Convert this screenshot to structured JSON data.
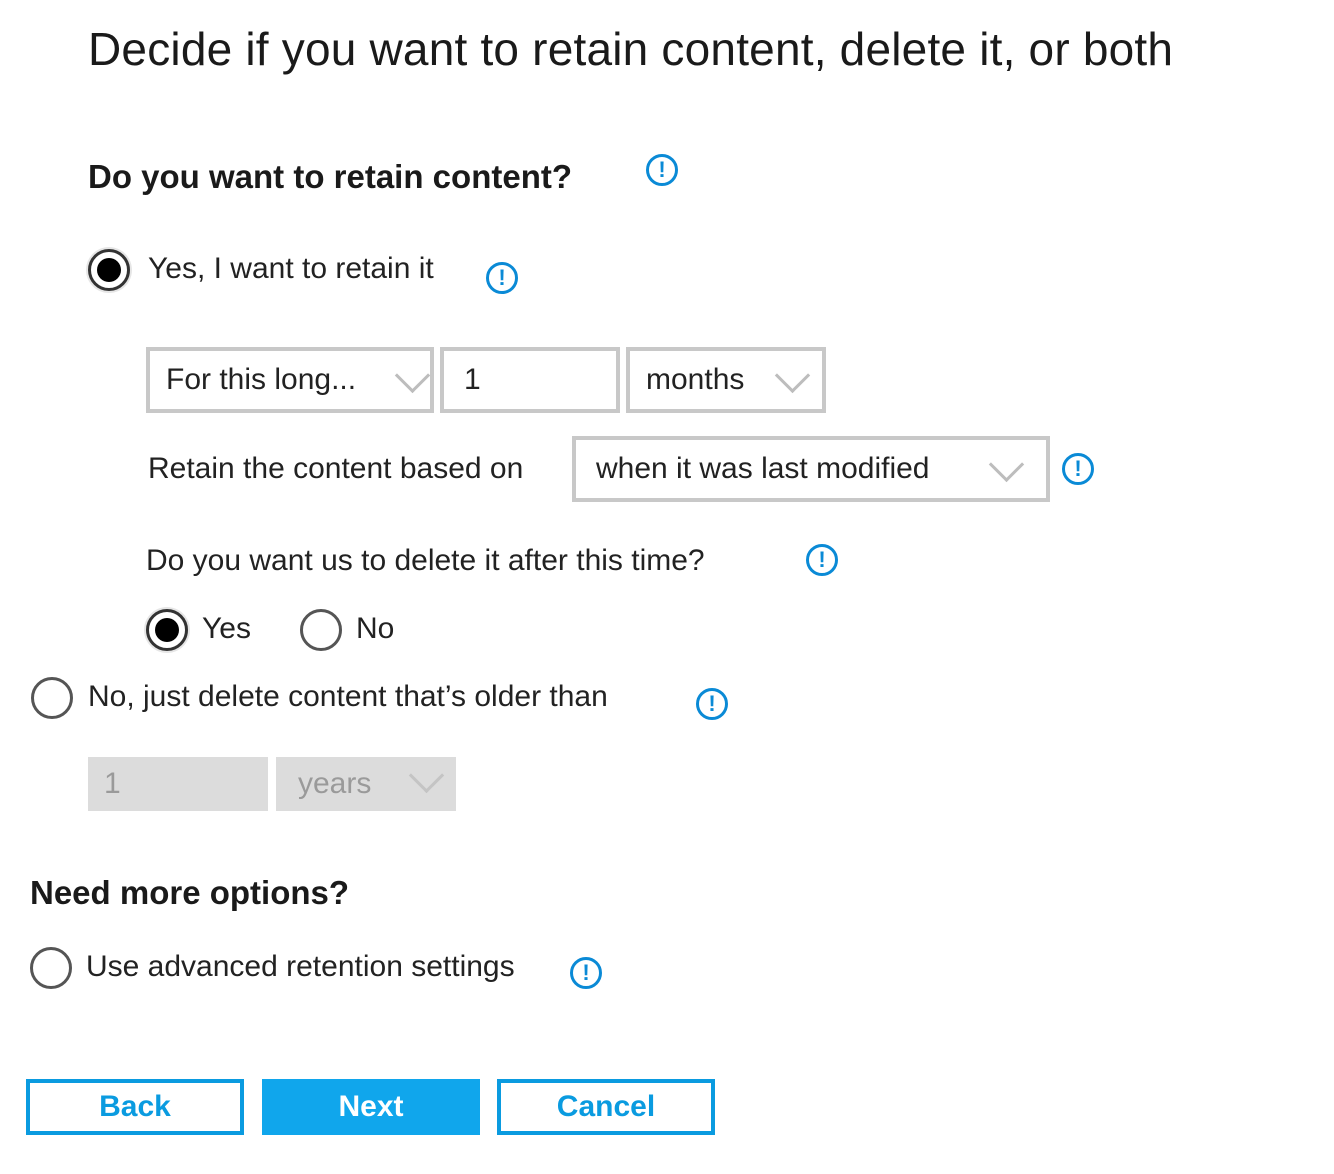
{
  "page": {
    "title": "Decide if you want to retain content, delete it, or both"
  },
  "retain_section": {
    "heading": "Do you want to retain content?",
    "yes_option": {
      "label": "Yes, I want to retain it",
      "checked": true
    },
    "duration": {
      "mode_value": "For this long...",
      "amount_value": "1",
      "unit_value": "months"
    },
    "based_on": {
      "label": "Retain the content based on",
      "value": "when it was last modified"
    },
    "delete_after": {
      "question": "Do you want us to delete it after this time?",
      "yes_label": "Yes",
      "no_label": "No",
      "selected": "Yes"
    },
    "no_option": {
      "label": "No, just delete content that’s older than",
      "checked": false,
      "amount_value": "1",
      "unit_value": "years"
    }
  },
  "more_options": {
    "heading": "Need more options?",
    "advanced_label": "Use advanced retention settings"
  },
  "buttons": {
    "back": "Back",
    "next": "Next",
    "cancel": "Cancel"
  },
  "colors": {
    "accent": "#10a6ec",
    "info_icon": "#0a8ad6"
  },
  "icons": {
    "info": "info-circle-icon",
    "dropdown": "chevron-down-icon"
  }
}
